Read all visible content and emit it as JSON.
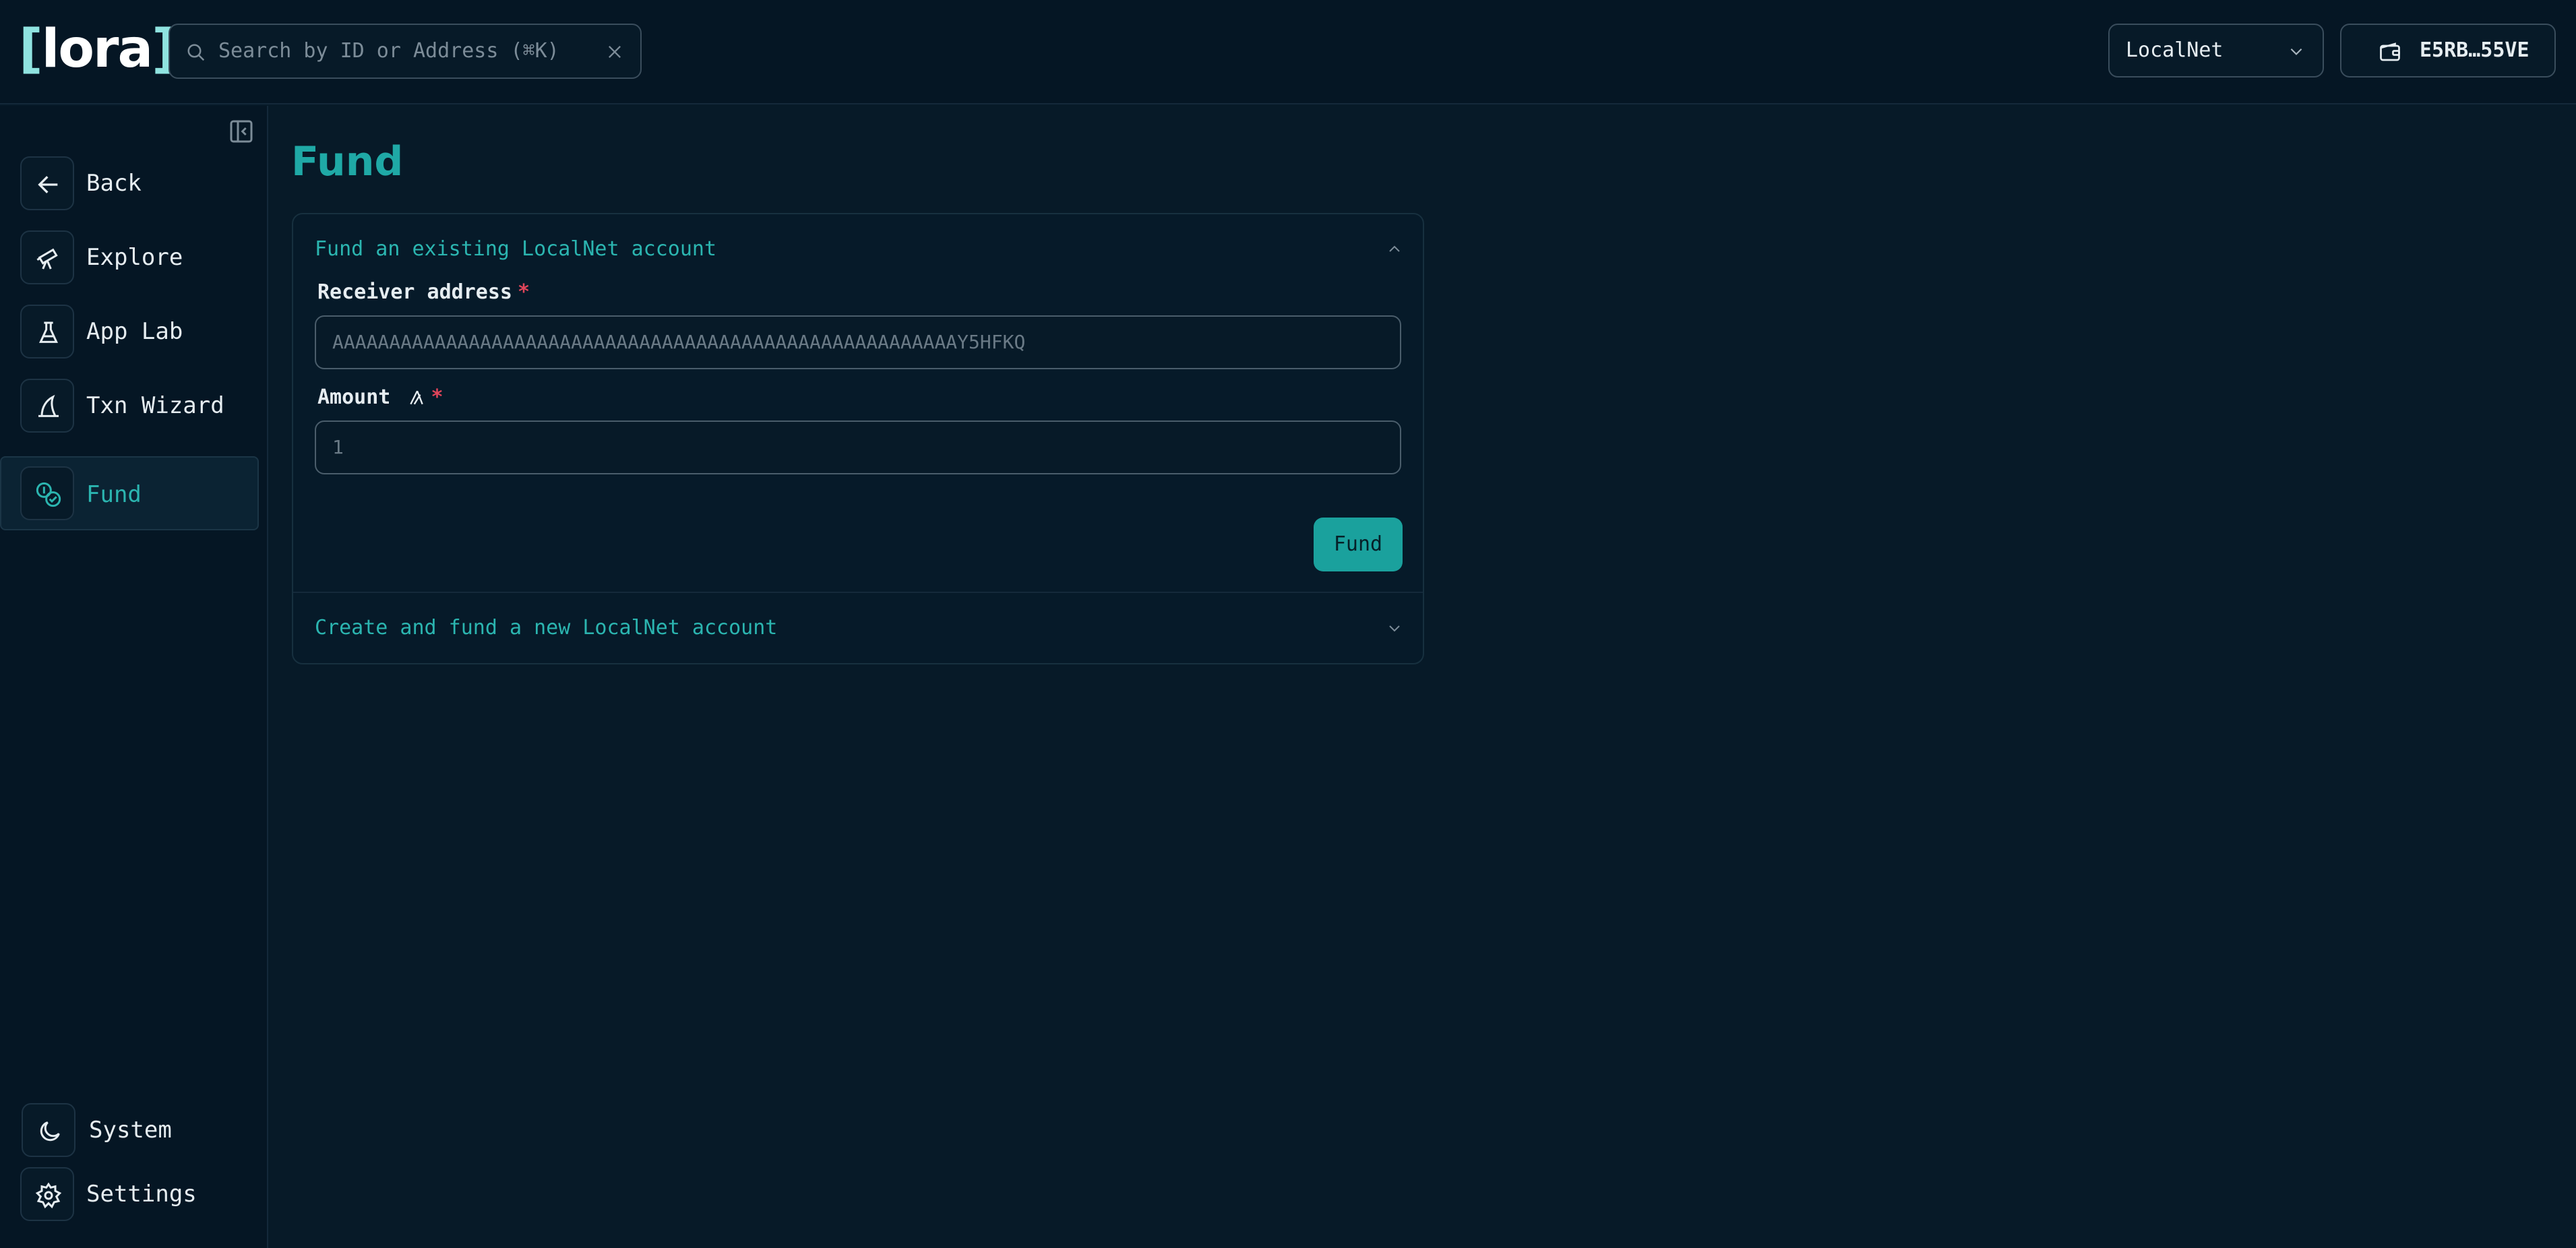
{
  "header": {
    "logo": "lora",
    "search_placeholder": "Search by ID or Address (⌘K)",
    "network": "LocalNet",
    "wallet": "E5RB…55VE"
  },
  "sidebar": {
    "items": [
      {
        "label": "Back",
        "icon": "arrow-left-icon"
      },
      {
        "label": "Explore",
        "icon": "telescope-icon"
      },
      {
        "label": "App Lab",
        "icon": "flask-icon"
      },
      {
        "label": "Txn Wizard",
        "icon": "wizard-hat-icon"
      },
      {
        "label": "Fund",
        "icon": "coins-icon",
        "active": true
      }
    ],
    "bottom": [
      {
        "label": "System",
        "icon": "moon-icon"
      },
      {
        "label": "Settings",
        "icon": "gear-icon"
      }
    ]
  },
  "main": {
    "title": "Fund",
    "existing": {
      "title": "Fund an existing LocalNet account",
      "receiver_label": "Receiver address",
      "receiver_placeholder": "AAAAAAAAAAAAAAAAAAAAAAAAAAAAAAAAAAAAAAAAAAAAAAAAAAAAAAAY5HFKQ",
      "amount_label": "Amount",
      "amount_placeholder": "1",
      "required_mark": "*",
      "button": "Fund"
    },
    "create": {
      "title": "Create and fund a new LocalNet account"
    }
  },
  "colors": {
    "accent": "#1fa9a6",
    "background": "#071a28",
    "required": "#e0455a"
  }
}
